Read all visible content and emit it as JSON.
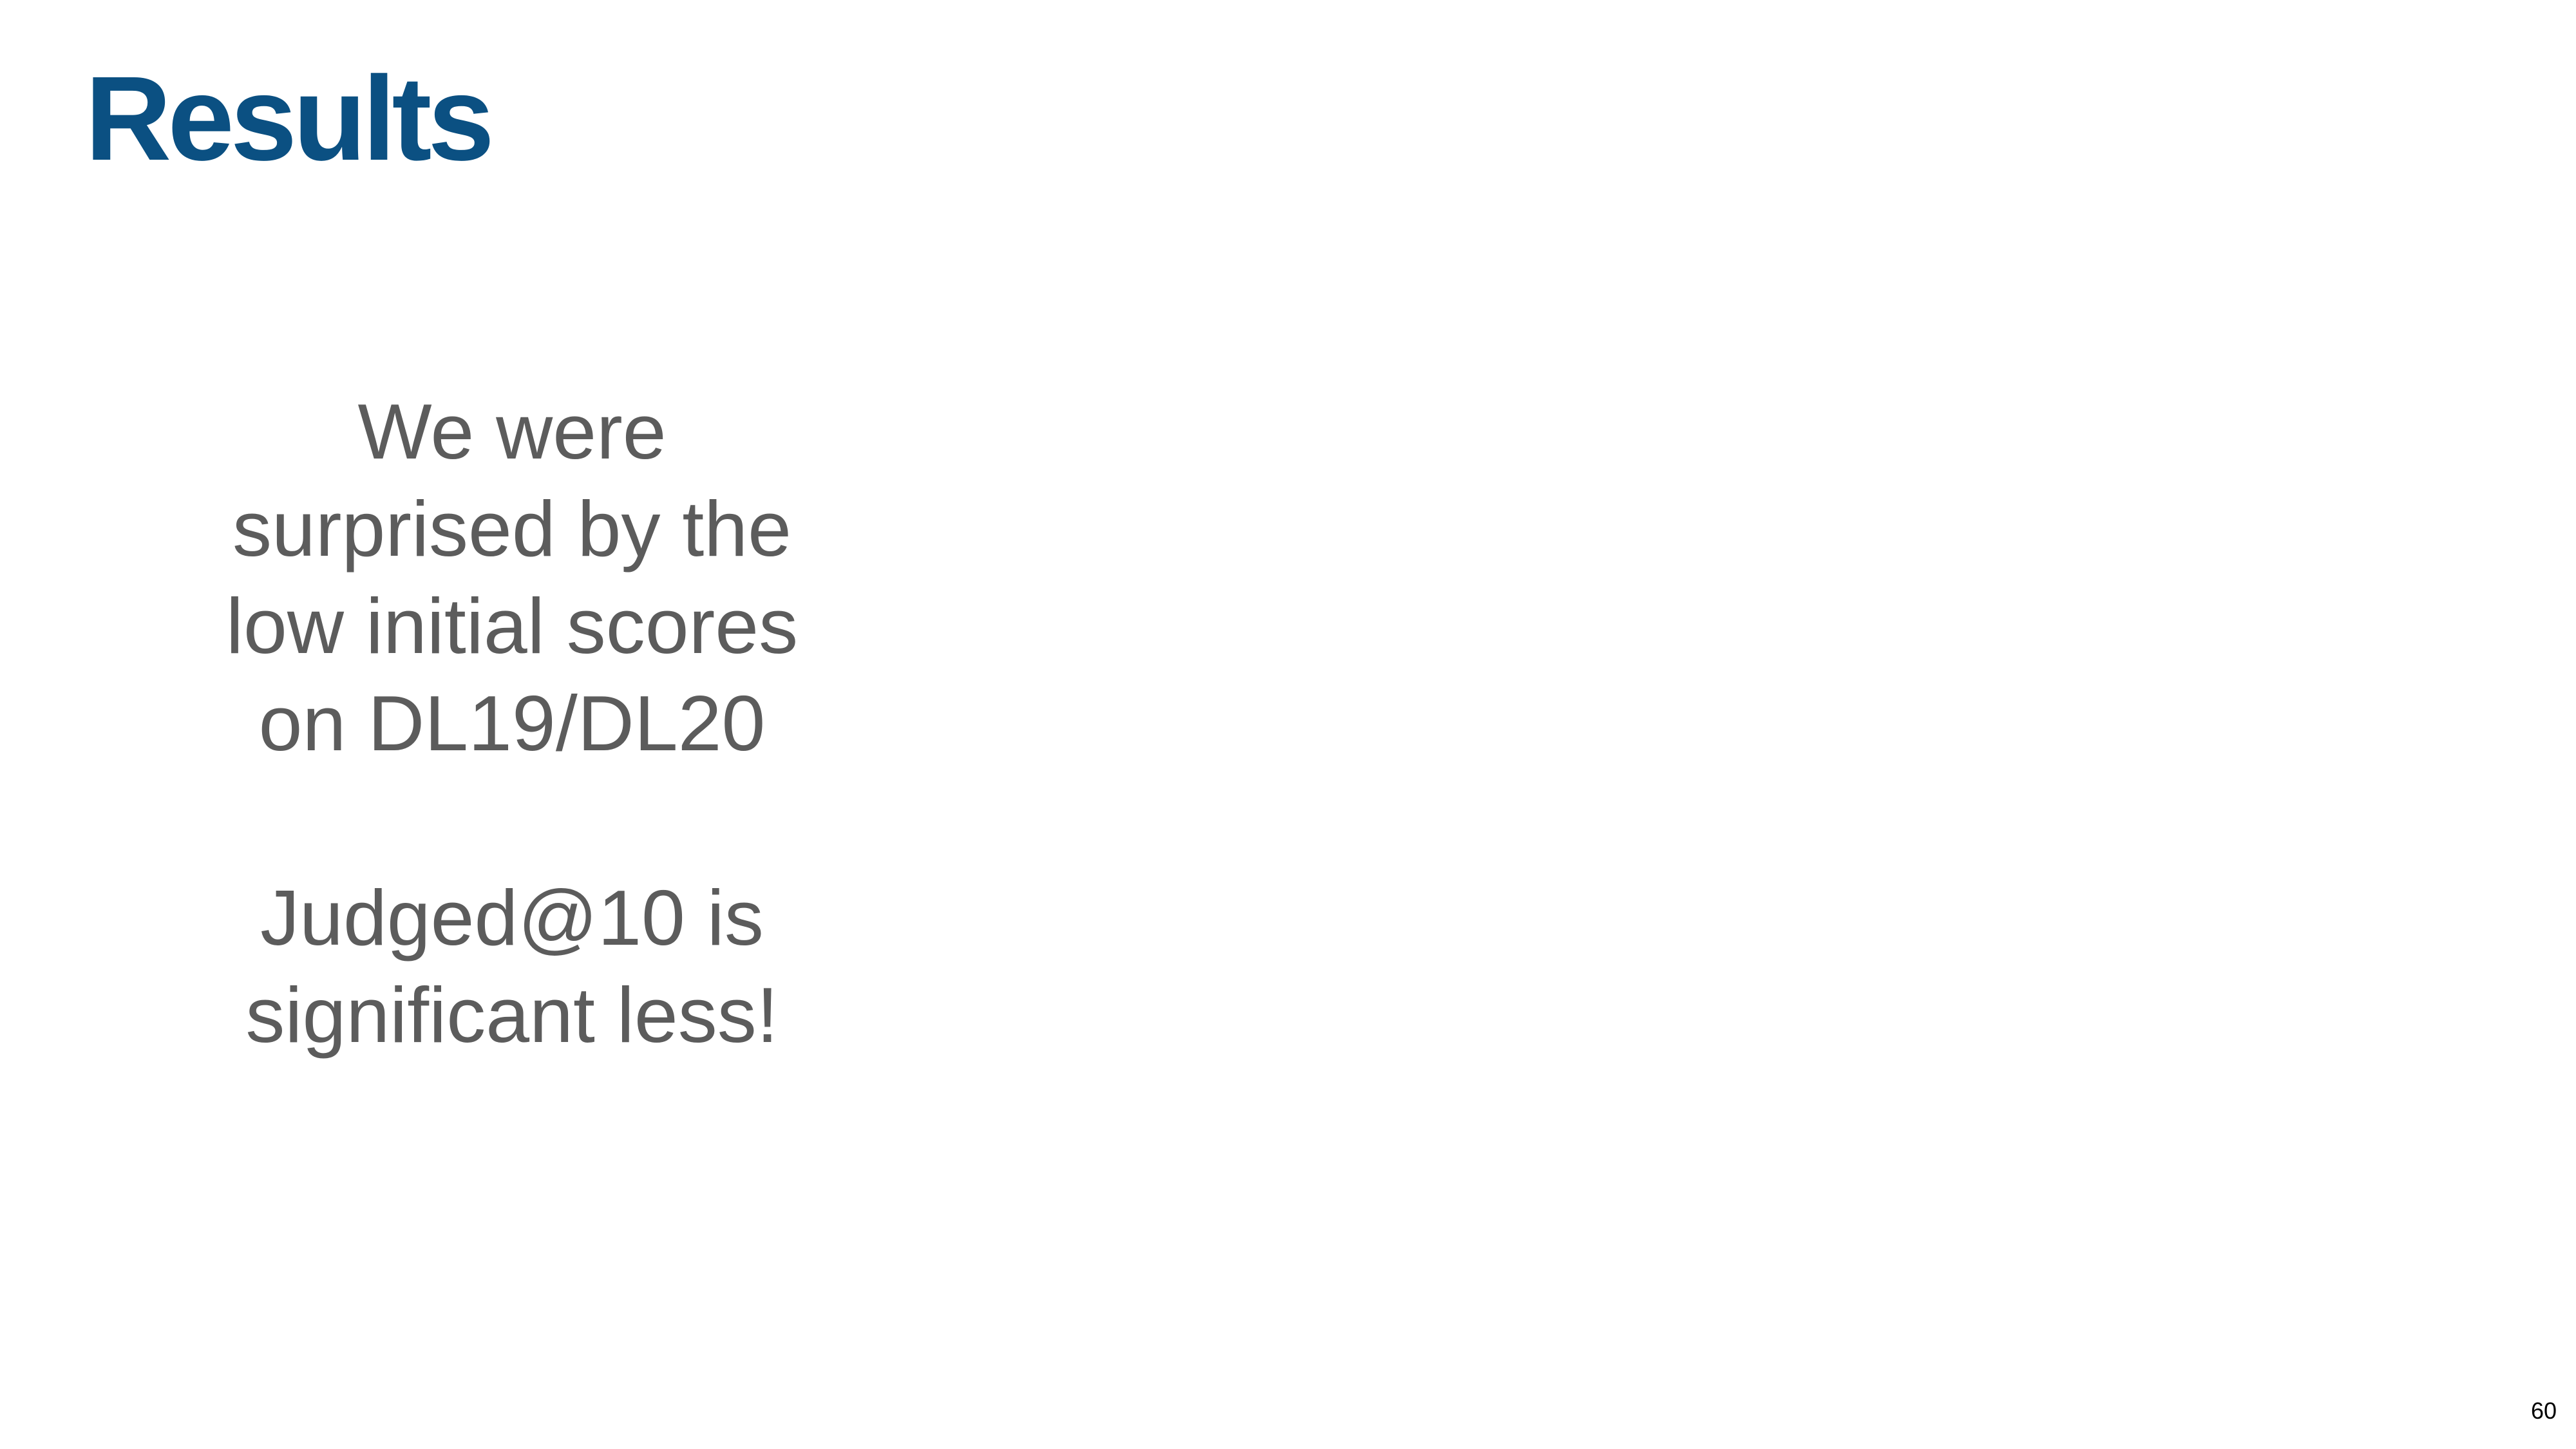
{
  "slide": {
    "title": "Results",
    "paragraphs": [
      [
        "We were",
        "surprised by the",
        "low initial scores",
        "on DL19/DL20"
      ],
      [
        "Judged@10 is",
        "significant less!"
      ]
    ],
    "page_number": "60"
  },
  "colors": {
    "title": "#0b5082",
    "body_text": "#5c5c5c",
    "background": "#ffffff"
  }
}
